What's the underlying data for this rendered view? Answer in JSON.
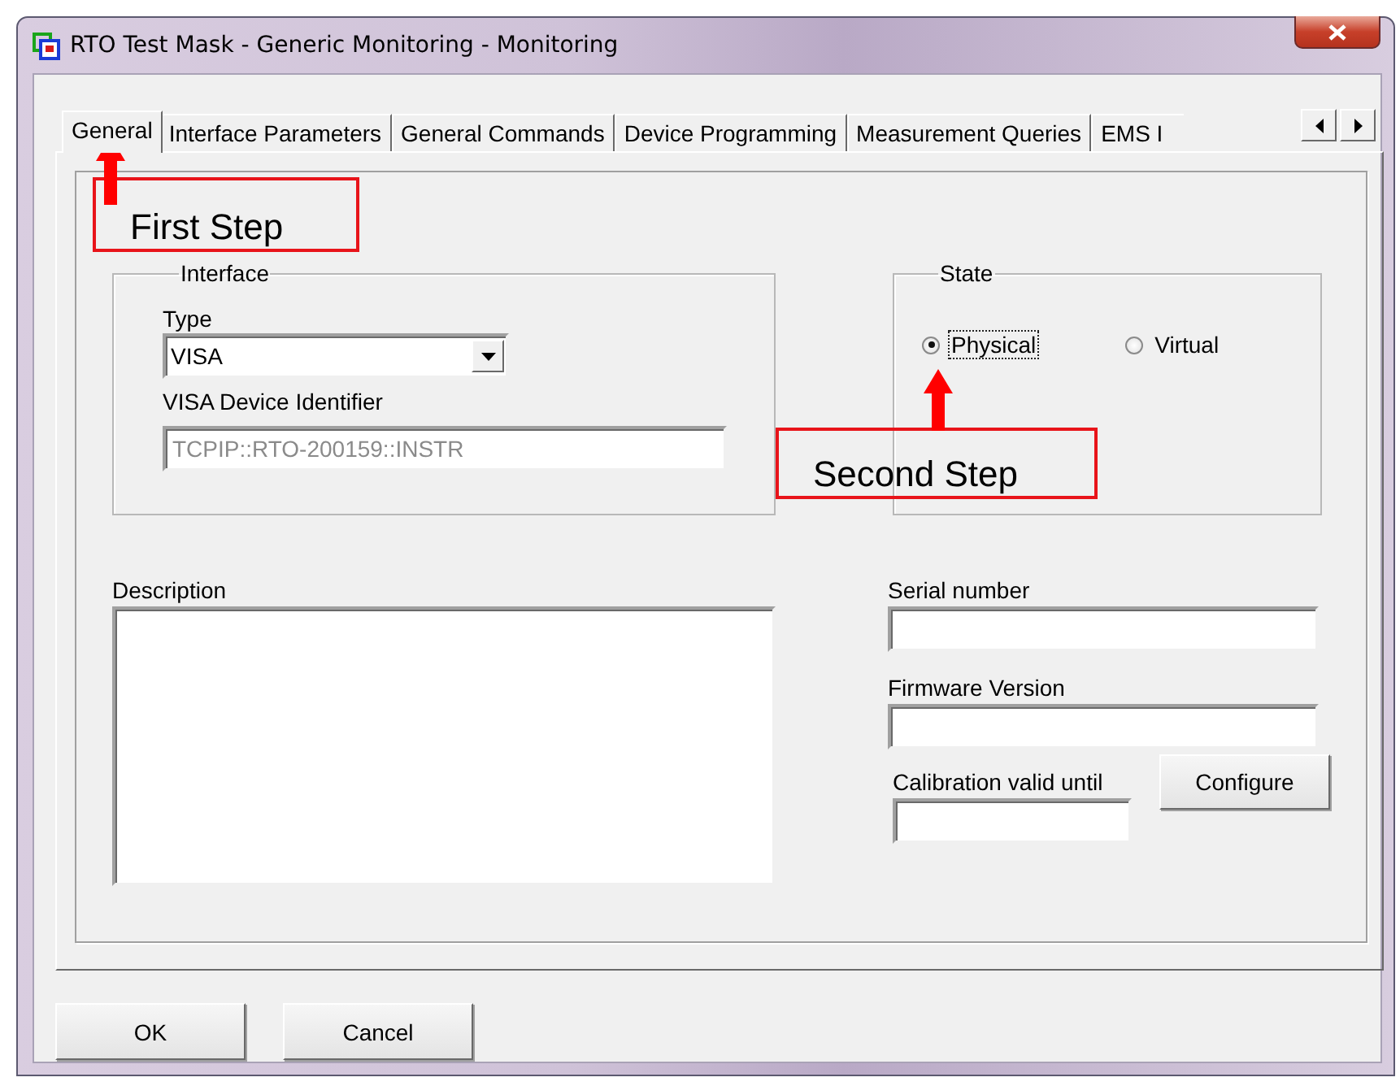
{
  "window": {
    "title": "RTO Test Mask - Generic Monitoring - Monitoring"
  },
  "tabs": [
    {
      "label": "General",
      "selected": true
    },
    {
      "label": "Interface Parameters",
      "selected": false
    },
    {
      "label": "General Commands",
      "selected": false
    },
    {
      "label": "Device Programming",
      "selected": false
    },
    {
      "label": "Measurement Queries",
      "selected": false
    },
    {
      "label": "EMS I",
      "selected": false
    }
  ],
  "interface": {
    "title": "Interface",
    "type_label": "Type",
    "type": {
      "value": "VISA"
    },
    "identifier_label": "VISA Device Identifier",
    "identifier": {
      "value": "TCPIP::RTO-200159::INSTR",
      "disabled": true
    }
  },
  "state": {
    "title": "State",
    "options": [
      {
        "label": "Physical",
        "selected": true,
        "focused": true
      },
      {
        "label": "Virtual",
        "selected": false,
        "focused": false
      }
    ]
  },
  "description": {
    "label": "Description"
  },
  "serial_number": {
    "label": "Serial number"
  },
  "firmware_version": {
    "label": "Firmware Version"
  },
  "calibration": {
    "label": "Calibration valid until",
    "button": "Configure"
  },
  "buttons": [
    "OK",
    "Cancel"
  ],
  "annotations": [
    {
      "text": "First Step"
    },
    {
      "text": "Second Step"
    }
  ]
}
